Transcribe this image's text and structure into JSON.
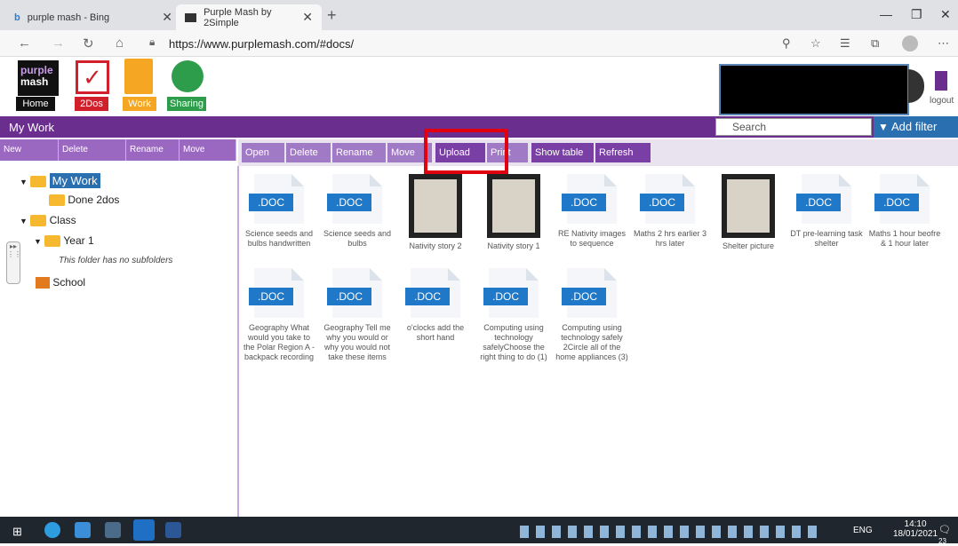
{
  "browser": {
    "tabs": [
      {
        "title": "purple mash - Bing"
      },
      {
        "title": "Purple Mash by 2Simple"
      }
    ],
    "url": "https://www.purplemash.com/#docs/"
  },
  "apps": [
    {
      "label": "Home"
    },
    {
      "label": "2Dos"
    },
    {
      "label": "Work"
    },
    {
      "label": "Sharing"
    }
  ],
  "header": {
    "logo_line1": "purple",
    "logo_line2": "mash",
    "logout": "logout"
  },
  "section_title": "My Work",
  "search": {
    "placeholder": "Search"
  },
  "add_filter": "Add filter",
  "left_toolbar": [
    "New",
    "Delete",
    "Rename",
    "Move"
  ],
  "right_toolbar": [
    "Open",
    "Delete",
    "Rename",
    "Move",
    "Upload",
    "Print",
    "Show table",
    "Refresh"
  ],
  "tree": {
    "my_work": "My Work",
    "done": "Done 2dos",
    "class": "Class",
    "year1": "Year 1",
    "no_sub": "This folder has no subfolders",
    "school": "School"
  },
  "files": [
    {
      "name": "Science seeds and bulbs handwritten",
      "kind": "doc",
      "badge": ".DOC"
    },
    {
      "name": "Science seeds and bulbs",
      "kind": "doc",
      "badge": ".DOC"
    },
    {
      "name": "Nativity story 2",
      "kind": "image"
    },
    {
      "name": "Nativity story 1",
      "kind": "image"
    },
    {
      "name": "RE Nativity images to sequence",
      "kind": "doc",
      "badge": ".DOC"
    },
    {
      "name": "Maths 2 hrs earlier 3 hrs later",
      "kind": "doc",
      "badge": ".DOC"
    },
    {
      "name": "Shelter picture",
      "kind": "image"
    },
    {
      "name": "DT pre-learning task shelter",
      "kind": "doc",
      "badge": ".DOC"
    },
    {
      "name": "Maths 1 hour beofre & 1 hour later",
      "kind": "doc",
      "badge": ".DOC"
    },
    {
      "name": "Geography What would you take to the Polar Region A - backpack recording",
      "kind": "doc",
      "badge": ".DOC"
    },
    {
      "name": "Geography Tell me why you would or why you would not take these items",
      "kind": "doc",
      "badge": ".DOC"
    },
    {
      "name": "o'clocks add the short hand",
      "kind": "doc",
      "badge": ".DOC"
    },
    {
      "name": "Computing using technology safelyChoose the right thing to do (1)",
      "kind": "doc",
      "badge": ".DOC"
    },
    {
      "name": "Computing using technology safely 2Circle all of the home appliances (3)",
      "kind": "doc",
      "badge": ".DOC"
    }
  ],
  "taskbar": {
    "lang": "ENG",
    "time": "14:10",
    "date": "18/01/2021",
    "notif": "23"
  }
}
